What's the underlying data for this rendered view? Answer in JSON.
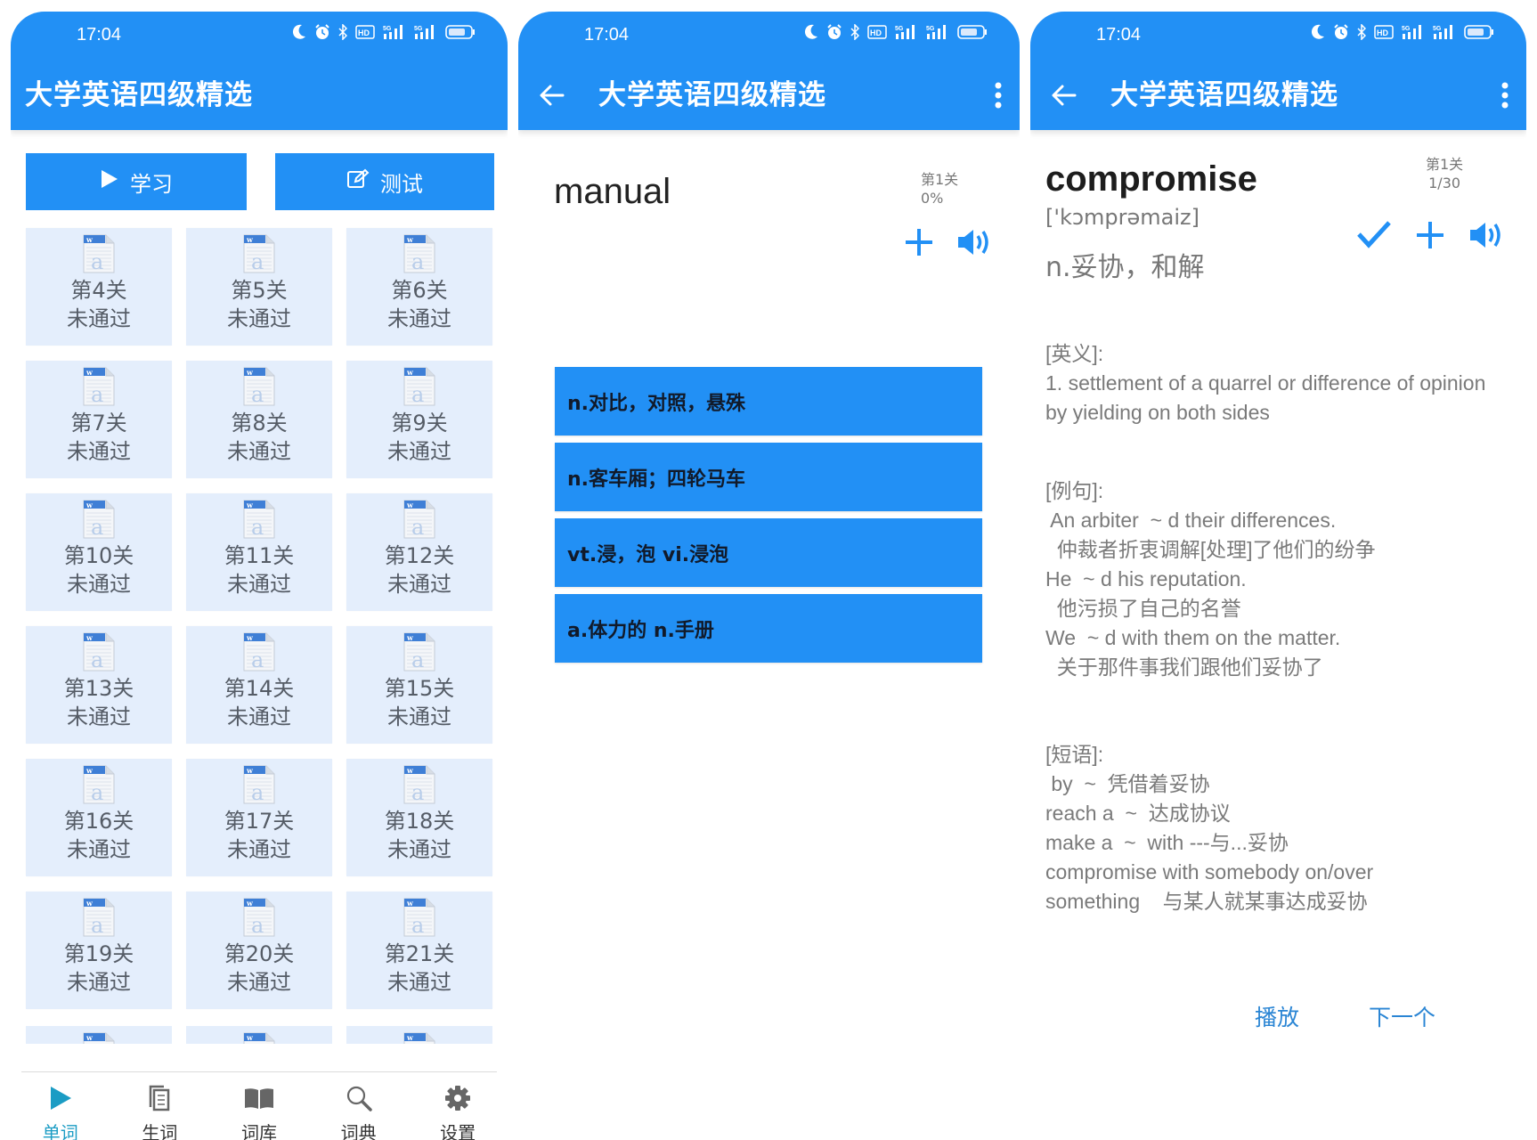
{
  "status_bar": {
    "time": "17:04",
    "icons": [
      "moon-icon",
      "alarm-icon",
      "bluetooth-icon",
      "hd-icon",
      "signal-5g-icon",
      "signal-5g-icon",
      "battery-icon"
    ]
  },
  "app_title": "大学英语四级精选",
  "colors": {
    "primary": "#2290f5",
    "tile_bg": "#e4eefc",
    "active_nav": "#1b9cc4",
    "link": "#2a85d4"
  },
  "home": {
    "study_label": "学习",
    "test_label": "测试",
    "levels": [
      {
        "name": "第4关",
        "status": "未通过"
      },
      {
        "name": "第5关",
        "status": "未通过"
      },
      {
        "name": "第6关",
        "status": "未通过"
      },
      {
        "name": "第7关",
        "status": "未通过"
      },
      {
        "name": "第8关",
        "status": "未通过"
      },
      {
        "name": "第9关",
        "status": "未通过"
      },
      {
        "name": "第10关",
        "status": "未通过"
      },
      {
        "name": "第11关",
        "status": "未通过"
      },
      {
        "name": "第12关",
        "status": "未通过"
      },
      {
        "name": "第13关",
        "status": "未通过"
      },
      {
        "name": "第14关",
        "status": "未通过"
      },
      {
        "name": "第15关",
        "status": "未通过"
      },
      {
        "name": "第16关",
        "status": "未通过"
      },
      {
        "name": "第17关",
        "status": "未通过"
      },
      {
        "name": "第18关",
        "status": "未通过"
      },
      {
        "name": "第19关",
        "status": "未通过"
      },
      {
        "name": "第20关",
        "status": "未通过"
      },
      {
        "name": "第21关",
        "status": "未通过"
      }
    ],
    "bottom_nav": [
      {
        "label": "单词",
        "icon": "play-icon",
        "active": true
      },
      {
        "label": "生词",
        "icon": "notes-icon",
        "active": false
      },
      {
        "label": "词库",
        "icon": "book-icon",
        "active": false
      },
      {
        "label": "词典",
        "icon": "search-icon",
        "active": false
      },
      {
        "label": "设置",
        "icon": "gear-icon",
        "active": false
      }
    ]
  },
  "quiz": {
    "word": "manual",
    "level": "第1关",
    "progress": "0%",
    "options": [
      "n.对比，对照，悬殊",
      "n.客车厢；四轮马车",
      "vt.浸，泡 vi.浸泡",
      "a.体力的 n.手册"
    ]
  },
  "detail": {
    "word": "compromise",
    "phonetic": "['kɔmprəmaiz]",
    "meaning": "n.妥协，和解",
    "level": "第1关",
    "progress": "1/30",
    "english_def_header": "[英义]:",
    "english_def": " 1. settlement of a quarrel or difference of opinion by yielding on both sides",
    "examples_header": "[例句]:",
    "examples": [
      " An arbiter  ~ d their differences.",
      "  仲裁者折衷调解[处理]了他们的纷争",
      "He  ~ d his reputation.",
      "  他污损了自己的名誉",
      "We  ~ d with them on the matter.",
      "  关于那件事我们跟他们妥协了"
    ],
    "phrases_header": "[短语]:",
    "phrases": [
      " by  ~  凭借着妥协",
      "reach a  ~  达成协议",
      "make a  ~  with ---与...妥协",
      "compromise with somebody on/over",
      "something    与某人就某事达成妥协"
    ],
    "play_label": "播放",
    "next_label": "下一个"
  }
}
